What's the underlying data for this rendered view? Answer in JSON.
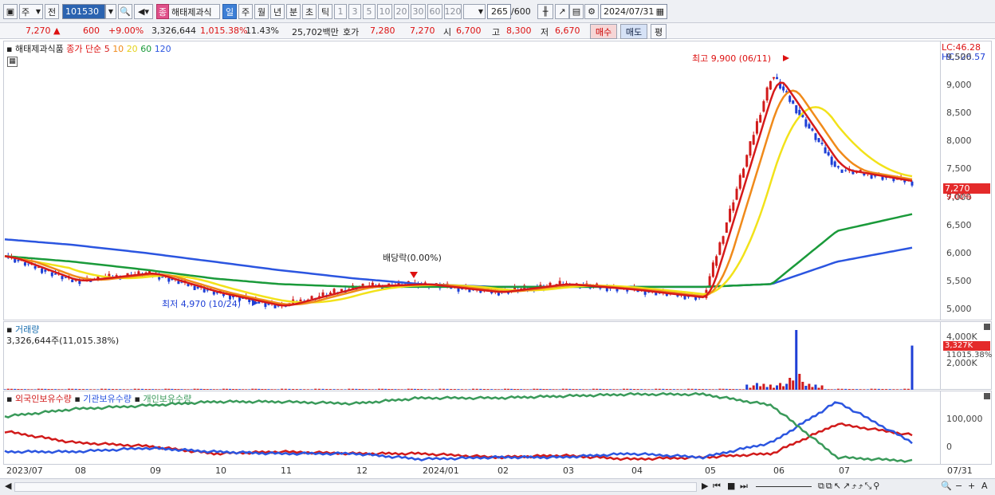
{
  "toolbar": {
    "market": "주",
    "period_mode": "전",
    "code": "101530",
    "stock_name": "해태제과식",
    "timeframes": [
      "일",
      "주",
      "월",
      "년",
      "분",
      "초",
      "틱"
    ],
    "intervals": [
      "1",
      "3",
      "5",
      "10",
      "20",
      "30",
      "60",
      "120"
    ],
    "count": "265",
    "count_total": "/600",
    "date": "2024/07/31",
    "selected_tab": "일"
  },
  "quote": {
    "price": "7,270",
    "arrow": "▲",
    "change": "600",
    "change_pct": "+9.00%",
    "volume": "3,326,644",
    "volume_pct": "1,015.38%",
    "turnover": "11.43%",
    "amount": "25,702백만",
    "bid_label": "호가",
    "bid": "7,280",
    "ask": "7,270",
    "open_label": "시",
    "open": "6,700",
    "high_label": "고",
    "high": "8,300",
    "low_label": "저",
    "low": "6,670",
    "buy": "매수",
    "sell": "매도",
    "eval": "평"
  },
  "price_panel": {
    "title": "해태제과식품",
    "ma_label": "종가 단순",
    "ma_periods": [
      "5",
      "10",
      "20",
      "60",
      "120"
    ],
    "lc": "LC:46.28",
    "hc": "HC:-26.57",
    "y_ticks": [
      "9,500",
      "9,000",
      "8,500",
      "8,000",
      "7,500",
      "7,000",
      "6,500",
      "6,000",
      "5,500",
      "5,000"
    ],
    "current_price_tag": "7,270",
    "pct_tag": "9.00%",
    "high_annotation": "최고 9,900 (06/11)",
    "low_annotation": "최저 4,970 (10/24)",
    "dividend_annotation": "배당락(0.00%)"
  },
  "volume_panel": {
    "title": "거래량",
    "value": "3,326,644주(11,015.38%)",
    "y_ticks": [
      "4,000K",
      "2,000K"
    ],
    "tag": "3,327K",
    "tag2": "11015.38%"
  },
  "holding_panel": {
    "series": [
      "외국인보유수량",
      "기관보유수량",
      "개인보유수량"
    ],
    "y_ticks": [
      "100,000",
      "0"
    ]
  },
  "x_axis": [
    "2023/07",
    "08",
    "09",
    "10",
    "11",
    "12",
    "2024/01",
    "02",
    "03",
    "04",
    "05",
    "06",
    "07"
  ],
  "x_right": "07/31",
  "colors": {
    "up": "#d11a1a",
    "down": "#1e3fd6",
    "ma5": "#d61a1a",
    "ma10": "#f08a1a",
    "ma20": "#f2e21a",
    "ma60": "#1a9a3a",
    "ma120": "#2b55e0",
    "foreign": "#d11a1a",
    "inst": "#2b55e0",
    "indiv": "#3a9a5a"
  },
  "chart_data": [
    {
      "type": "line",
      "title": "해태제과식품",
      "x": [
        "2023/07",
        "08",
        "09",
        "10",
        "11",
        "12",
        "2024/01",
        "02",
        "03",
        "04",
        "05",
        "06",
        "07",
        "07/31"
      ],
      "series": [
        {
          "name": "종가",
          "values": [
            5950,
            5500,
            5650,
            5300,
            5050,
            5400,
            5450,
            5300,
            5450,
            5350,
            5200,
            9200,
            7500,
            7270
          ]
        },
        {
          "name": "60",
          "values": [
            5950,
            5850,
            5700,
            5550,
            5450,
            5400,
            5400,
            5400,
            5400,
            5400,
            5400,
            5450,
            6400,
            6700
          ]
        },
        {
          "name": "120",
          "values": [
            6250,
            6150,
            6000,
            5850,
            5700,
            5550,
            5450,
            5400,
            5400,
            5400,
            5400,
            5450,
            5850,
            6100
          ]
        }
      ],
      "ylim": [
        4800,
        9800
      ]
    },
    {
      "type": "bar",
      "title": "거래량",
      "x": [
        "2023/07",
        "…",
        "06",
        "07/31"
      ],
      "values": [
        30,
        40,
        4500,
        3327
      ],
      "ylabel": "K"
    },
    {
      "type": "line",
      "x": [
        "2023/07",
        "08",
        "09",
        "10",
        "11",
        "12",
        "2024/01",
        "02",
        "03",
        "04",
        "05",
        "06",
        "07",
        "07/31"
      ],
      "series": [
        {
          "name": "외국인보유수량",
          "values": [
            50000,
            20000,
            10000,
            -10000,
            -5000,
            -10000,
            -10000,
            -20000,
            -15000,
            -25000,
            -20000,
            -10000,
            70000,
            40000
          ]
        },
        {
          "name": "기관보유수량",
          "values": [
            -5000,
            -5000,
            5000,
            -5000,
            -10000,
            -10000,
            -25000,
            -20000,
            -20000,
            -10000,
            -20000,
            20000,
            130000,
            20000
          ]
        },
        {
          "name": "개인보유수량",
          "values": [
            90000,
            110000,
            120000,
            130000,
            130000,
            125000,
            140000,
            140000,
            145000,
            150000,
            150000,
            120000,
            -20000,
            -30000
          ]
        }
      ],
      "ylim": [
        -40000,
        160000
      ]
    }
  ]
}
